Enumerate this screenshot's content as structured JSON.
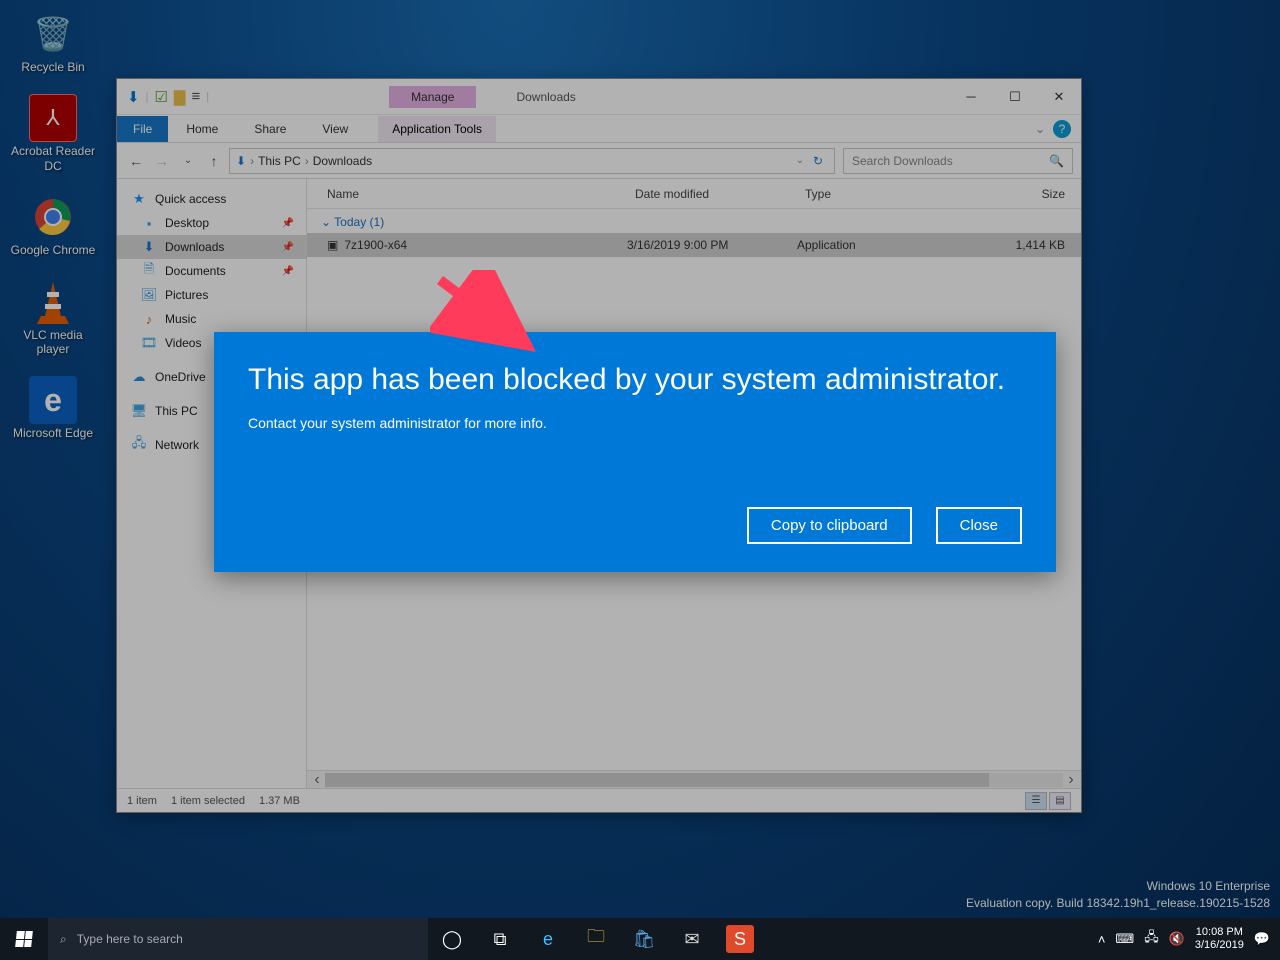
{
  "desktop": {
    "icons": [
      {
        "id": "recycle-bin",
        "label": "Recycle Bin"
      },
      {
        "id": "acrobat",
        "label": "Acrobat Reader DC"
      },
      {
        "id": "chrome",
        "label": "Google Chrome"
      },
      {
        "id": "vlc",
        "label": "VLC media player"
      },
      {
        "id": "edge",
        "label": "Microsoft Edge"
      }
    ]
  },
  "explorer": {
    "manage_tab": "Manage",
    "title": "Downloads",
    "ribbon": {
      "file": "File",
      "home": "Home",
      "share": "Share",
      "view": "View",
      "app_tools": "Application Tools"
    },
    "breadcrumb": {
      "root": "This PC",
      "folder": "Downloads"
    },
    "search_placeholder": "Search Downloads",
    "sidebar": {
      "quick_access": "Quick access",
      "items": [
        "Desktop",
        "Downloads",
        "Documents",
        "Pictures",
        "Music",
        "Videos"
      ],
      "onedrive": "OneDrive",
      "this_pc": "This PC",
      "network": "Network"
    },
    "columns": {
      "name": "Name",
      "date": "Date modified",
      "type": "Type",
      "size": "Size"
    },
    "group": "Today (1)",
    "file": {
      "name": "7z1900-x64",
      "date": "3/16/2019 9:00 PM",
      "type": "Application",
      "size": "1,414 KB"
    },
    "status": {
      "items": "1 item",
      "selected": "1 item selected",
      "size": "1.37 MB"
    }
  },
  "dialog": {
    "heading": "This app has been blocked by your system administrator.",
    "body": "Contact your system administrator for more info.",
    "copy": "Copy to clipboard",
    "close": "Close"
  },
  "watermark": {
    "line1": "Windows 10 Enterprise",
    "line2": "Evaluation copy. Build 18342.19h1_release.190215-1528"
  },
  "taskbar": {
    "search_placeholder": "Type here to search",
    "time": "10:08 PM",
    "date": "3/16/2019"
  }
}
